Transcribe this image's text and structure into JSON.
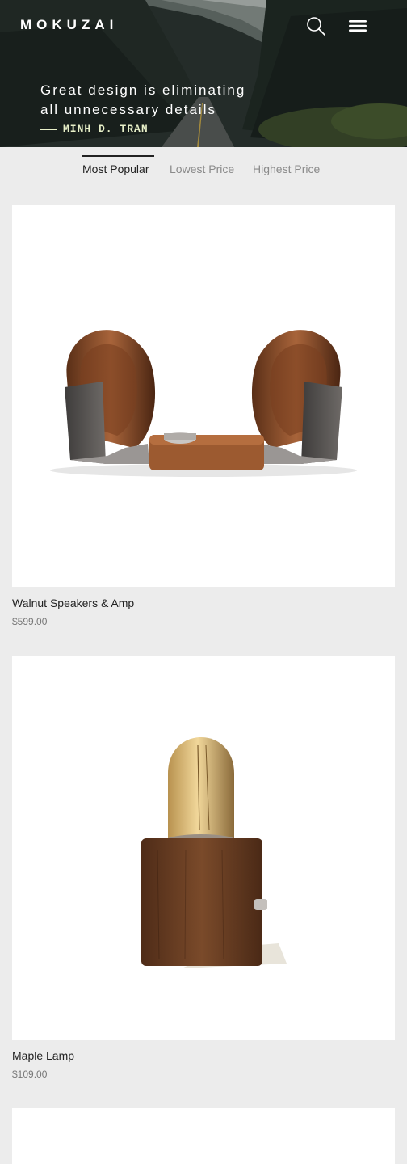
{
  "header": {
    "brand": "MOKUZAI",
    "quote_line1": "Great design is eliminating",
    "quote_line2": "all unnecessary details",
    "author": "MINH D. TRAN"
  },
  "sort_tabs": [
    {
      "label": "Most Popular",
      "active": true
    },
    {
      "label": "Lowest Price",
      "active": false
    },
    {
      "label": "Highest Price",
      "active": false
    }
  ],
  "products": [
    {
      "name": "Walnut Speakers & Amp",
      "price": "$599.00"
    },
    {
      "name": "Maple Lamp",
      "price": "$109.00"
    }
  ],
  "colors": {
    "background": "#ececec",
    "card": "#ffffff",
    "text": "#222222",
    "muted": "#8a8a8a",
    "author_accent": "#e8f0c8"
  },
  "icons": {
    "search": "search-icon",
    "menu": "hamburger-menu-icon"
  }
}
